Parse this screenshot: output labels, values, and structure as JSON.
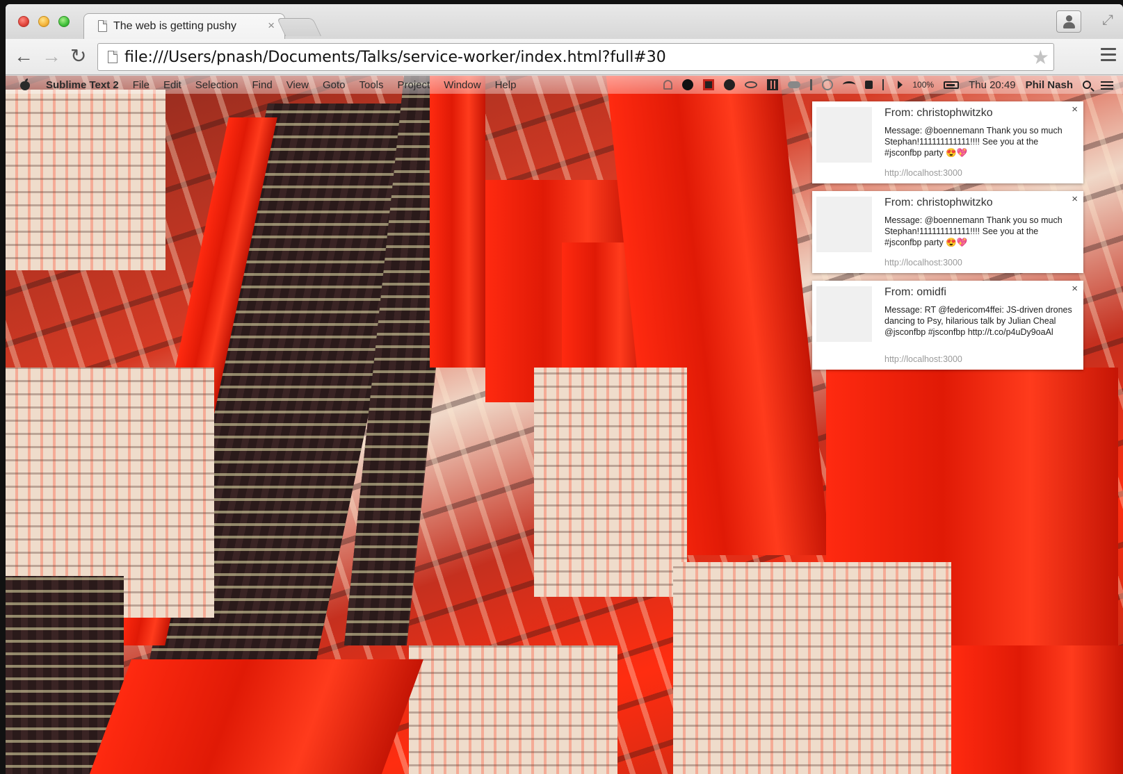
{
  "browser": {
    "tab_title": "The web is getting pushy",
    "tab_close": "×",
    "url": "file:///Users/pnash/Documents/Talks/service-worker/index.html?full#30",
    "nav_back": "←",
    "nav_forward": "→",
    "nav_reload": "↻",
    "star": "★",
    "fullscreen": "⤢"
  },
  "mac_menubar": {
    "app_name": "Sublime Text 2",
    "menus": [
      "File",
      "Edit",
      "Selection",
      "Find",
      "View",
      "Goto",
      "Tools",
      "Project",
      "Window",
      "Help"
    ],
    "battery": "100%",
    "clock": "Thu 20:49",
    "user": "Phil Nash"
  },
  "notifications": [
    {
      "from": "From: christophwitzko",
      "message": "Message: @boennemann Thank you so much Stephan!111111111111!!!! See you at the #jsconfbp party 😍💖",
      "source": "http://localhost:3000",
      "close": "×"
    },
    {
      "from": "From: christophwitzko",
      "message": "Message: @boennemann Thank you so much Stephan!111111111111!!!! See you at the #jsconfbp party 😍💖",
      "source": "http://localhost:3000",
      "close": "×"
    },
    {
      "from": "From: omidfi",
      "message": "Message: RT @federicom4ffei: JS-driven drones dancing to Psy, hilarious talk by Julian Cheal @jsconfbp #jsconfbp http://t.co/p4uDy9oaAl",
      "source": "http://localhost:3000",
      "close": "×"
    }
  ],
  "colors": {
    "accent_red": "#ff2a10",
    "dark_tower": "#3a2424",
    "pale_tower": "#efdccb"
  }
}
